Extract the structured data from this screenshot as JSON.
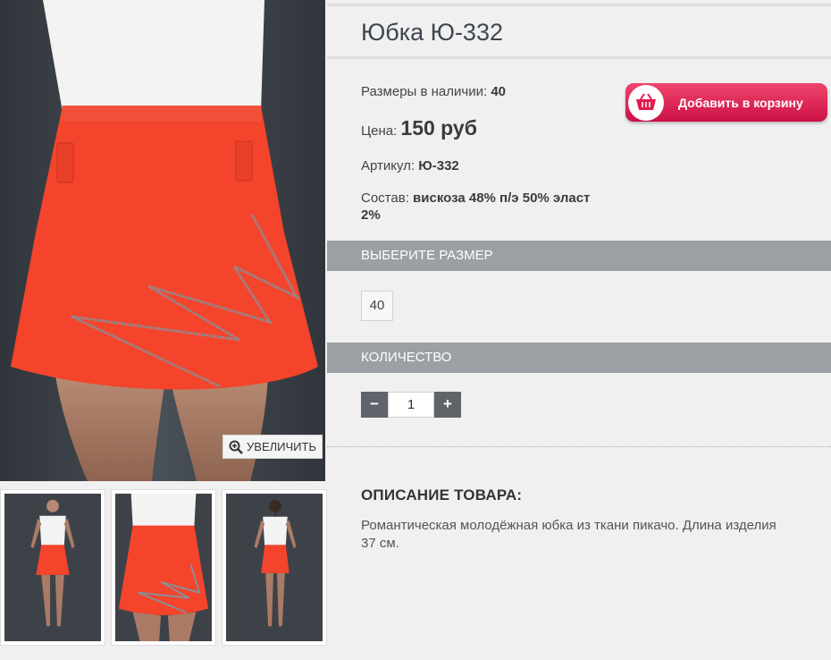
{
  "product": {
    "title": "Юбка Ю-332",
    "sizes_available_label": "Размеры в наличии:",
    "sizes_available_value": "40",
    "price_label": "Цена:",
    "price_value": "150 руб",
    "article_label": "Артикул:",
    "article_value": "Ю-332",
    "composition_label": "Состав:",
    "composition_value_line1": "вискоза 48% п/э 50% эласт",
    "composition_value_line2": "2%"
  },
  "cart": {
    "label": "Добавить в корзину",
    "icon": "basket-icon"
  },
  "gallery": {
    "zoom_label": "УВЕЛИЧИТЬ",
    "zoom_icon": "zoom-in-icon"
  },
  "size_section": {
    "heading": "ВЫБЕРИТЕ РАЗМЕР",
    "options": [
      "40"
    ]
  },
  "quantity_section": {
    "heading": "КОЛИЧЕСТВО",
    "minus_label": "−",
    "plus_label": "+",
    "value": "1"
  },
  "description": {
    "heading": "ОПИСАНИЕ ТОВАРА:",
    "text": "Романтическая молодёжная юбка из ткани пикачо. Длина изделия 37 см."
  },
  "colors": {
    "accent": "#e31b4f",
    "section_bar": "#9c9fa3",
    "skirt": "#f4442c",
    "photo_bg": "#3d4249"
  }
}
